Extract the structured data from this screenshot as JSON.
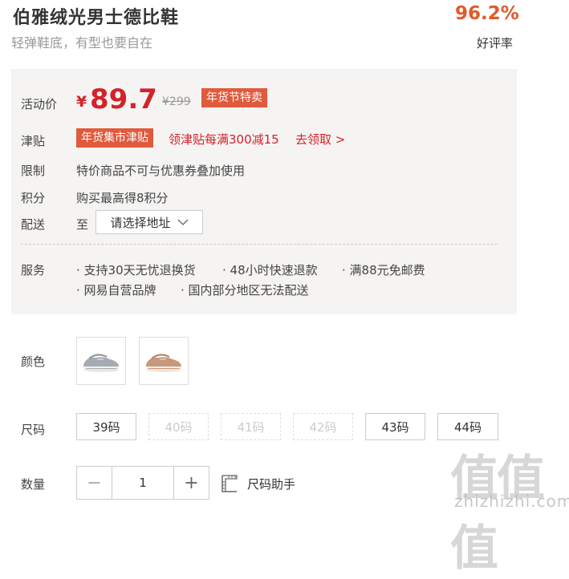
{
  "product": {
    "title": "伯雅绒光男士德比鞋",
    "subtitle": "轻弹鞋底，有型也要自在",
    "rating_value": "96.2%",
    "rating_label": "好评率"
  },
  "price": {
    "label": "活动价",
    "currency": "¥",
    "amount": "89.7",
    "original": "¥299",
    "promo_tag": "年货节特卖"
  },
  "subsidy": {
    "label": "津贴",
    "tag": "年货集市津贴",
    "text": "领津贴每满300减15",
    "link": "去领取 >"
  },
  "limit": {
    "label": "限制",
    "text": "特价商品不可与优惠券叠加使用"
  },
  "points": {
    "label": "积分",
    "text": "购买最高得8积分"
  },
  "delivery": {
    "label": "配送",
    "to": "至",
    "select": "请选择地址"
  },
  "service": {
    "label": "服务",
    "items": [
      "· 支持30天无忧退换货",
      "· 48小时快速退款",
      "· 满88元免邮费",
      "· 网易自营品牌",
      "· 国内部分地区无法配送"
    ]
  },
  "color": {
    "label": "颜色",
    "options": [
      "grey",
      "tan"
    ]
  },
  "size": {
    "label": "尺码",
    "options": [
      {
        "label": "39码",
        "available": true
      },
      {
        "label": "40码",
        "available": false
      },
      {
        "label": "41码",
        "available": false
      },
      {
        "label": "42码",
        "available": false
      },
      {
        "label": "43码",
        "available": true
      },
      {
        "label": "44码",
        "available": true
      }
    ]
  },
  "quantity": {
    "label": "数量",
    "value": "1",
    "minus": "−",
    "plus": "+",
    "size_guide": "尺码助手"
  },
  "watermark": {
    "mark": "值值值",
    "text": "zhizhizhi.com"
  }
}
